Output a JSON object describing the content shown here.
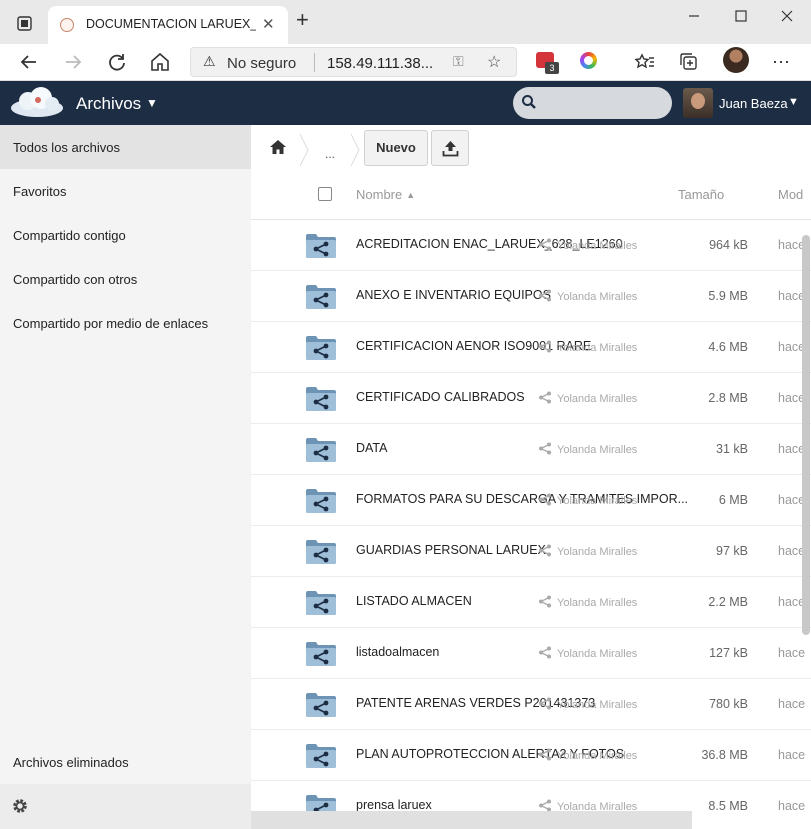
{
  "browser": {
    "tab_title": "DOCUMENTACION LARUEX_GES",
    "security_label": "No seguro",
    "url": "158.49.111.38...",
    "extension_badge": "3"
  },
  "app": {
    "title": "Archivos",
    "search_placeholder": "",
    "user_name": "Juan Baeza"
  },
  "sidebar": {
    "items": [
      {
        "label": "Todos los archivos",
        "active": true
      },
      {
        "label": "Favoritos"
      },
      {
        "label": "Compartido contigo"
      },
      {
        "label": "Compartido con otros"
      },
      {
        "label": "Compartido por medio de enlaces"
      }
    ],
    "deleted_label": "Archivos eliminados"
  },
  "toolbar": {
    "breadcrumb_ellipsis": "...",
    "new_label": "Nuevo"
  },
  "table": {
    "headers": {
      "name": "Nombre",
      "size": "Tamaño",
      "modified": "Mod"
    },
    "rows": [
      {
        "name": "ACREDITACION ENAC_LARUEX_628_LE1260",
        "shared_by": "Yolanda Miralles",
        "size": "964 kB",
        "modified": "hace"
      },
      {
        "name": "ANEXO E INVENTARIO EQUIPOS",
        "shared_by": "Yolanda Miralles",
        "size": "5.9 MB",
        "modified": "hace"
      },
      {
        "name": "CERTIFICACION AENOR ISO9001 RARE",
        "shared_by": "Yolanda Miralles",
        "size": "4.6 MB",
        "modified": "hace"
      },
      {
        "name": "CERTIFICADO CALIBRADOS",
        "shared_by": "Yolanda Miralles",
        "size": "2.8 MB",
        "modified": "hace"
      },
      {
        "name": "DATA",
        "shared_by": "Yolanda Miralles",
        "size": "31 kB",
        "modified": "hace"
      },
      {
        "name": "FORMATOS PARA SU DESCARGA Y TRAMITES IMPOR...",
        "shared_by": "Yolanda Miralles",
        "size": "6 MB",
        "modified": "hace"
      },
      {
        "name": "GUARDIAS PERSONAL LARUEX",
        "shared_by": "Yolanda Miralles",
        "size": "97 kB",
        "modified": "hace"
      },
      {
        "name": "LISTADO ALMACEN",
        "shared_by": "Yolanda Miralles",
        "size": "2.2 MB",
        "modified": "hace"
      },
      {
        "name": "listadoalmacen",
        "shared_by": "Yolanda Miralles",
        "size": "127 kB",
        "modified": "hace"
      },
      {
        "name": "PATENTE ARENAS VERDES P201431373",
        "shared_by": "Yolanda Miralles",
        "size": "780 kB",
        "modified": "hace"
      },
      {
        "name": "PLAN AUTOPROTECCION ALERTA2 Y FOTOS",
        "shared_by": "Yolanda Miralles",
        "size": "36.8 MB",
        "modified": "hace"
      },
      {
        "name": "prensa laruex",
        "shared_by": "Yolanda Miralles",
        "size": "8.5 MB",
        "modified": "hace"
      }
    ]
  }
}
